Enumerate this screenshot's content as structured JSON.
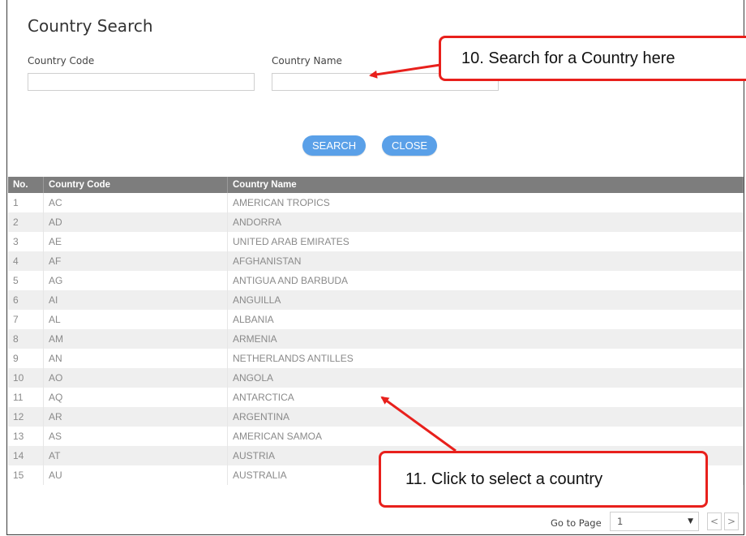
{
  "dialog": {
    "title": "Country Search",
    "code_label": "Country Code",
    "name_label": "Country Name",
    "code_value": "",
    "name_value": "",
    "search_button": "SEARCH",
    "close_button": "CLOSE"
  },
  "table": {
    "headers": [
      "No.",
      "Country Code",
      "Country Name"
    ],
    "rows": [
      [
        "1",
        "AC",
        "AMERICAN TROPICS"
      ],
      [
        "2",
        "AD",
        "ANDORRA"
      ],
      [
        "3",
        "AE",
        "UNITED ARAB EMIRATES"
      ],
      [
        "4",
        "AF",
        "AFGHANISTAN"
      ],
      [
        "5",
        "AG",
        "ANTIGUA AND BARBUDA"
      ],
      [
        "6",
        "AI",
        "ANGUILLA"
      ],
      [
        "7",
        "AL",
        "ALBANIA"
      ],
      [
        "8",
        "AM",
        "ARMENIA"
      ],
      [
        "9",
        "AN",
        "NETHERLANDS ANTILLES"
      ],
      [
        "10",
        "AO",
        "ANGOLA"
      ],
      [
        "11",
        "AQ",
        "ANTARCTICA"
      ],
      [
        "12",
        "AR",
        "ARGENTINA"
      ],
      [
        "13",
        "AS",
        "AMERICAN SAMOA"
      ],
      [
        "14",
        "AT",
        "AUSTRIA"
      ],
      [
        "15",
        "AU",
        "AUSTRALIA"
      ]
    ]
  },
  "pager": {
    "label": "Go to Page",
    "selected_page": "1",
    "prev_symbol": "<",
    "next_symbol": ">"
  },
  "annotations": {
    "callout_search": "10. Search for a Country here",
    "callout_select": "11. Click to select a country",
    "callout_color": "#e8201c"
  },
  "colors": {
    "button_blue": "#5aa0e8",
    "header_gray": "#7d7d7d",
    "row_alt": "#efefef"
  }
}
